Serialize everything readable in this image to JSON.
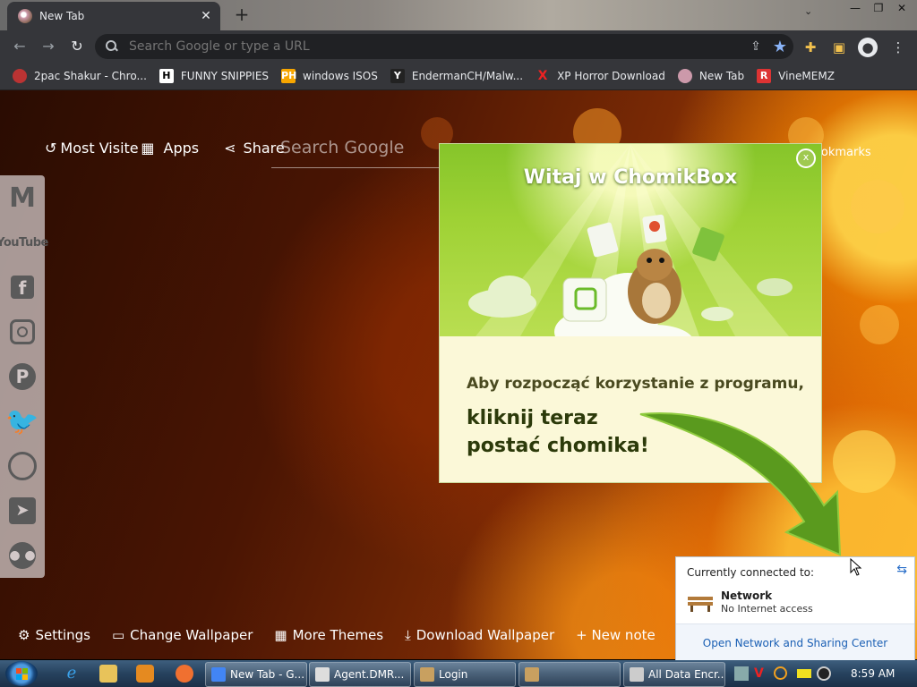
{
  "browser": {
    "tab_title": "New Tab",
    "tab_close": "✕",
    "new_tab": "+",
    "omnibox_placeholder": "Search Google or type a URL",
    "bookmarks": [
      {
        "label": "2pac Shakur - Chro...",
        "icon": "tupac-icon",
        "color": "#b33"
      },
      {
        "label": "FUNNY SNIPPIES",
        "icon": "H",
        "color": "#fff"
      },
      {
        "label": "windows ISOS",
        "icon": "PH",
        "color": "#f7a600"
      },
      {
        "label": "EndermanCH/Malw...",
        "icon": "Y",
        "color": "#222"
      },
      {
        "label": "XP Horror Download",
        "icon": "X",
        "color": "#e22"
      },
      {
        "label": "New Tab",
        "icon": "chrome-favicon",
        "color": "#c9a"
      },
      {
        "label": "VineMEMZ",
        "icon": "R",
        "color": "#d33"
      }
    ]
  },
  "ntp": {
    "most_visited": "Most Visited",
    "apps": "Apps",
    "share": "Share",
    "search_placeholder": "Search Google",
    "bookmarks": "Bookmarks",
    "social": [
      "gmail",
      "youtube",
      "facebook",
      "instagram",
      "pinterest",
      "twitter",
      "whatsapp",
      "telegram",
      "reddit"
    ],
    "youtube_label": "YouTube",
    "bottom": {
      "settings": "Settings",
      "change_wallpaper": "Change Wallpaper",
      "more_themes": "More Themes",
      "download_wallpaper": "Download Wallpaper",
      "new_note": "+ New note"
    }
  },
  "chomikbox": {
    "title": "Witaj w ChomikBox",
    "close": "x",
    "line1": "Aby rozpocząć korzystanie z programu,",
    "line2": "kliknij teraz postać chomika!"
  },
  "network_popup": {
    "header": "Currently connected to:",
    "network_name": "Network",
    "network_status": "No Internet access",
    "link": "Open Network and Sharing Center"
  },
  "taskbar": {
    "buttons": [
      {
        "label": "New Tab - G...",
        "icon_color": "#4285f4"
      },
      {
        "label": "Agent.DMR...",
        "icon_color": "#ddd"
      },
      {
        "label": "Login",
        "icon_color": "#c8a060"
      },
      {
        "label": "",
        "icon_color": "#c8a060"
      },
      {
        "label": "All Data Encr...",
        "icon_color": "#ccc"
      }
    ],
    "clock": "8:59 AM"
  }
}
